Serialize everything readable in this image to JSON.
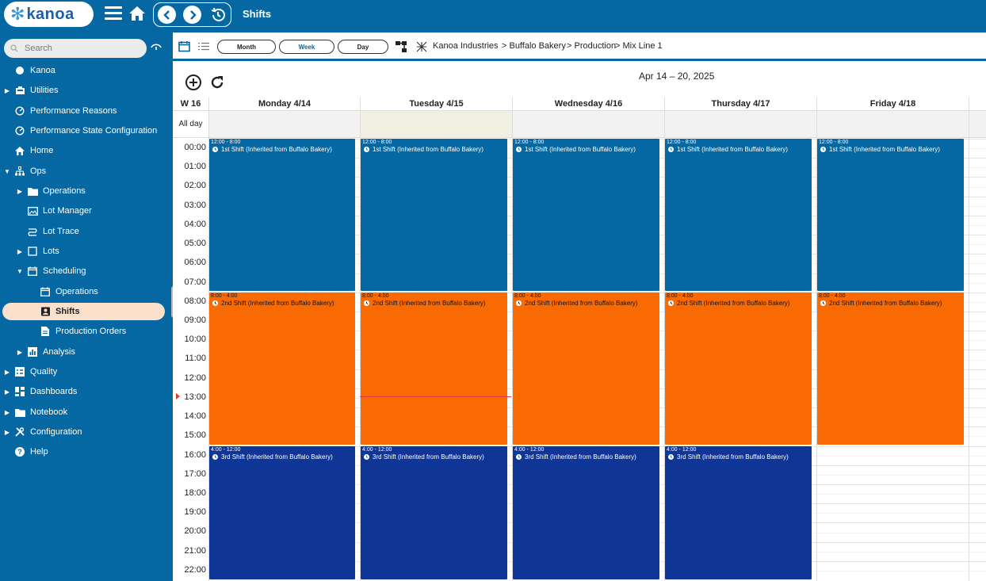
{
  "app": {
    "logo_text": "kanoa",
    "title": "Shifts"
  },
  "search": {
    "placeholder": "Search"
  },
  "sidebar": {
    "items": [
      {
        "label": "Kanoa",
        "icon": "kanoa-logo-icon"
      },
      {
        "label": "Utilities",
        "icon": "utilities-icon"
      },
      {
        "label": "Performance Reasons",
        "icon": "gauge-icon"
      },
      {
        "label": "Performance State Configuration",
        "icon": "gauge-icon"
      },
      {
        "label": "Home",
        "icon": "home-icon"
      },
      {
        "label": "Ops",
        "icon": "network-icon"
      },
      {
        "label": "Operations",
        "icon": "folder-icon"
      },
      {
        "label": "Lot Manager",
        "icon": "picture-icon"
      },
      {
        "label": "Lot Trace",
        "icon": "route-icon"
      },
      {
        "label": "Lots",
        "icon": "square-icon"
      },
      {
        "label": "Scheduling",
        "icon": "calendar-icon"
      },
      {
        "label": "Operations",
        "icon": "calendar-icon"
      },
      {
        "label": "Shifts",
        "icon": "badge-icon"
      },
      {
        "label": "Production Orders",
        "icon": "document-icon"
      },
      {
        "label": "Analysis",
        "icon": "chart-icon"
      },
      {
        "label": "Quality",
        "icon": "checklist-icon"
      },
      {
        "label": "Dashboards",
        "icon": "dashboard-icon"
      },
      {
        "label": "Notebook",
        "icon": "folder-icon"
      },
      {
        "label": "Configuration",
        "icon": "tools-icon"
      },
      {
        "label": "Help",
        "icon": "help-icon"
      }
    ]
  },
  "toolbar": {
    "month_label": "Month",
    "week_label": "Week",
    "day_label": "Day",
    "active_view": "Week",
    "breadcrumb": [
      "Kanoa Industries",
      "> Buffalo Bakery",
      "> Production",
      "> Mix Line 1"
    ]
  },
  "calendar": {
    "range_label": "Apr 14 – 20, 2025",
    "week_label": "W 16",
    "allday_label": "All day",
    "days": [
      "Monday 4/14",
      "Tuesday 4/15",
      "Wednesday 4/16",
      "Thursday 4/17",
      "Friday 4/18"
    ],
    "hours": [
      "00:00",
      "01:00",
      "02:00",
      "03:00",
      "04:00",
      "05:00",
      "06:00",
      "07:00",
      "08:00",
      "09:00",
      "10:00",
      "11:00",
      "12:00",
      "13:00",
      "14:00",
      "15:00",
      "16:00",
      "17:00",
      "18:00",
      "19:00",
      "20:00",
      "21:00",
      "22:00"
    ],
    "now_hour": "13:00",
    "events": [
      {
        "day": 0,
        "time": "12:00 - 8:00",
        "title": "1st Shift (Inherited from Buffalo Bakery)",
        "kind": "blue",
        "start": 0,
        "end": 8
      },
      {
        "day": 1,
        "time": "12:00 - 8:00",
        "title": "1st Shift (Inherited from Buffalo Bakery)",
        "kind": "blue",
        "start": 0,
        "end": 8
      },
      {
        "day": 2,
        "time": "12:00 - 8:00",
        "title": "1st Shift (Inherited from Buffalo Bakery)",
        "kind": "blue",
        "start": 0,
        "end": 8
      },
      {
        "day": 3,
        "time": "12:00 - 8:00",
        "title": "1st Shift (Inherited from Buffalo Bakery)",
        "kind": "blue",
        "start": 0,
        "end": 8
      },
      {
        "day": 4,
        "time": "12:00 - 8:00",
        "title": "1st Shift (Inherited from Buffalo Bakery)",
        "kind": "blue",
        "start": 0,
        "end": 8
      },
      {
        "day": 0,
        "time": "8:00 - 4:00",
        "title": "2nd Shift (Inherited from Buffalo Bakery)",
        "kind": "orange",
        "start": 8,
        "end": 16
      },
      {
        "day": 1,
        "time": "8:00 - 4:00",
        "title": "2nd Shift (Inherited from Buffalo Bakery)",
        "kind": "orange",
        "start": 8,
        "end": 16
      },
      {
        "day": 2,
        "time": "8:00 - 4:00",
        "title": "2nd Shift (Inherited from Buffalo Bakery)",
        "kind": "orange",
        "start": 8,
        "end": 16
      },
      {
        "day": 3,
        "time": "8:00 - 4:00",
        "title": "2nd Shift (Inherited from Buffalo Bakery)",
        "kind": "orange",
        "start": 8,
        "end": 16
      },
      {
        "day": 4,
        "time": "8:00 - 4:00",
        "title": "2nd Shift (Inherited from Buffalo Bakery)",
        "kind": "orange",
        "start": 8,
        "end": 16
      },
      {
        "day": 0,
        "time": "4:00 - 12:00",
        "title": "3rd Shift (Inherited from Buffalo Bakery)",
        "kind": "navy",
        "start": 16,
        "end": 24
      },
      {
        "day": 1,
        "time": "4:00 - 12:00",
        "title": "3rd Shift (Inherited from Buffalo Bakery)",
        "kind": "navy",
        "start": 16,
        "end": 24
      },
      {
        "day": 2,
        "time": "4:00 - 12:00",
        "title": "3rd Shift (Inherited from Buffalo Bakery)",
        "kind": "navy",
        "start": 16,
        "end": 24
      },
      {
        "day": 3,
        "time": "4:00 - 12:00",
        "title": "3rd Shift (Inherited from Buffalo Bakery)",
        "kind": "navy",
        "start": 16,
        "end": 24
      }
    ]
  },
  "colors": {
    "brand": "#0668a3",
    "shift1": "#0668a3",
    "shift2": "#f96a03",
    "shift3": "#0f3597",
    "selected_nav": "#fbe0cc",
    "today_allday": "#f1efe2",
    "now_line": "#e53935"
  }
}
